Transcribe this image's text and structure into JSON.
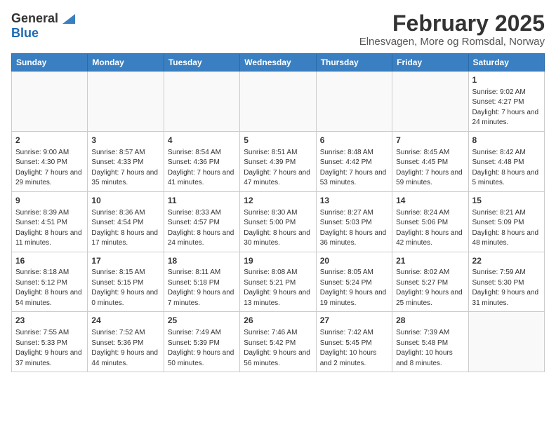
{
  "app": {
    "logo_general": "General",
    "logo_blue": "Blue"
  },
  "title": "February 2025",
  "subtitle": "Elnesvagen, More og Romsdal, Norway",
  "weekdays": [
    "Sunday",
    "Monday",
    "Tuesday",
    "Wednesday",
    "Thursday",
    "Friday",
    "Saturday"
  ],
  "weeks": [
    [
      {
        "day": "",
        "info": ""
      },
      {
        "day": "",
        "info": ""
      },
      {
        "day": "",
        "info": ""
      },
      {
        "day": "",
        "info": ""
      },
      {
        "day": "",
        "info": ""
      },
      {
        "day": "",
        "info": ""
      },
      {
        "day": "1",
        "info": "Sunrise: 9:02 AM\nSunset: 4:27 PM\nDaylight: 7 hours and 24 minutes."
      }
    ],
    [
      {
        "day": "2",
        "info": "Sunrise: 9:00 AM\nSunset: 4:30 PM\nDaylight: 7 hours and 29 minutes."
      },
      {
        "day": "3",
        "info": "Sunrise: 8:57 AM\nSunset: 4:33 PM\nDaylight: 7 hours and 35 minutes."
      },
      {
        "day": "4",
        "info": "Sunrise: 8:54 AM\nSunset: 4:36 PM\nDaylight: 7 hours and 41 minutes."
      },
      {
        "day": "5",
        "info": "Sunrise: 8:51 AM\nSunset: 4:39 PM\nDaylight: 7 hours and 47 minutes."
      },
      {
        "day": "6",
        "info": "Sunrise: 8:48 AM\nSunset: 4:42 PM\nDaylight: 7 hours and 53 minutes."
      },
      {
        "day": "7",
        "info": "Sunrise: 8:45 AM\nSunset: 4:45 PM\nDaylight: 7 hours and 59 minutes."
      },
      {
        "day": "8",
        "info": "Sunrise: 8:42 AM\nSunset: 4:48 PM\nDaylight: 8 hours and 5 minutes."
      }
    ],
    [
      {
        "day": "9",
        "info": "Sunrise: 8:39 AM\nSunset: 4:51 PM\nDaylight: 8 hours and 11 minutes."
      },
      {
        "day": "10",
        "info": "Sunrise: 8:36 AM\nSunset: 4:54 PM\nDaylight: 8 hours and 17 minutes."
      },
      {
        "day": "11",
        "info": "Sunrise: 8:33 AM\nSunset: 4:57 PM\nDaylight: 8 hours and 24 minutes."
      },
      {
        "day": "12",
        "info": "Sunrise: 8:30 AM\nSunset: 5:00 PM\nDaylight: 8 hours and 30 minutes."
      },
      {
        "day": "13",
        "info": "Sunrise: 8:27 AM\nSunset: 5:03 PM\nDaylight: 8 hours and 36 minutes."
      },
      {
        "day": "14",
        "info": "Sunrise: 8:24 AM\nSunset: 5:06 PM\nDaylight: 8 hours and 42 minutes."
      },
      {
        "day": "15",
        "info": "Sunrise: 8:21 AM\nSunset: 5:09 PM\nDaylight: 8 hours and 48 minutes."
      }
    ],
    [
      {
        "day": "16",
        "info": "Sunrise: 8:18 AM\nSunset: 5:12 PM\nDaylight: 8 hours and 54 minutes."
      },
      {
        "day": "17",
        "info": "Sunrise: 8:15 AM\nSunset: 5:15 PM\nDaylight: 9 hours and 0 minutes."
      },
      {
        "day": "18",
        "info": "Sunrise: 8:11 AM\nSunset: 5:18 PM\nDaylight: 9 hours and 7 minutes."
      },
      {
        "day": "19",
        "info": "Sunrise: 8:08 AM\nSunset: 5:21 PM\nDaylight: 9 hours and 13 minutes."
      },
      {
        "day": "20",
        "info": "Sunrise: 8:05 AM\nSunset: 5:24 PM\nDaylight: 9 hours and 19 minutes."
      },
      {
        "day": "21",
        "info": "Sunrise: 8:02 AM\nSunset: 5:27 PM\nDaylight: 9 hours and 25 minutes."
      },
      {
        "day": "22",
        "info": "Sunrise: 7:59 AM\nSunset: 5:30 PM\nDaylight: 9 hours and 31 minutes."
      }
    ],
    [
      {
        "day": "23",
        "info": "Sunrise: 7:55 AM\nSunset: 5:33 PM\nDaylight: 9 hours and 37 minutes."
      },
      {
        "day": "24",
        "info": "Sunrise: 7:52 AM\nSunset: 5:36 PM\nDaylight: 9 hours and 44 minutes."
      },
      {
        "day": "25",
        "info": "Sunrise: 7:49 AM\nSunset: 5:39 PM\nDaylight: 9 hours and 50 minutes."
      },
      {
        "day": "26",
        "info": "Sunrise: 7:46 AM\nSunset: 5:42 PM\nDaylight: 9 hours and 56 minutes."
      },
      {
        "day": "27",
        "info": "Sunrise: 7:42 AM\nSunset: 5:45 PM\nDaylight: 10 hours and 2 minutes."
      },
      {
        "day": "28",
        "info": "Sunrise: 7:39 AM\nSunset: 5:48 PM\nDaylight: 10 hours and 8 minutes."
      },
      {
        "day": "",
        "info": ""
      }
    ]
  ]
}
